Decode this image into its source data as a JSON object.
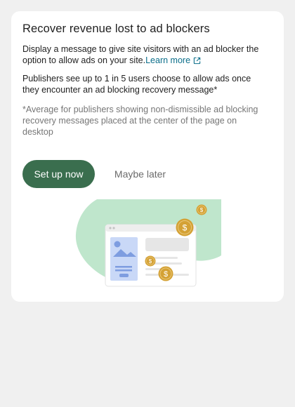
{
  "card": {
    "title": "Recover revenue lost to ad blockers",
    "description": "Display a message to give site visitors with an ad blocker the option to allow ads on your site.",
    "learn_more_label": "Learn more",
    "stat_text": "Publishers see up to 1 in 5 users choose to allow ads once they encounter an ad blocking recovery message*",
    "footnote": "*Average for publishers showing non-dismissible ad blocking recovery messages placed at the center of the page on desktop"
  },
  "actions": {
    "primary_label": "Set up now",
    "secondary_label": "Maybe later"
  },
  "illustration": {
    "coin_symbol": "$",
    "icon": "ad-recovery-illustration"
  },
  "colors": {
    "page_background": "#f0f0f0",
    "card_background": "#ffffff",
    "primary_button": "#3a6e4e",
    "link": "#0b6e8a",
    "illustration_blob": "#bfe6cc",
    "coin": "#d4a134"
  }
}
